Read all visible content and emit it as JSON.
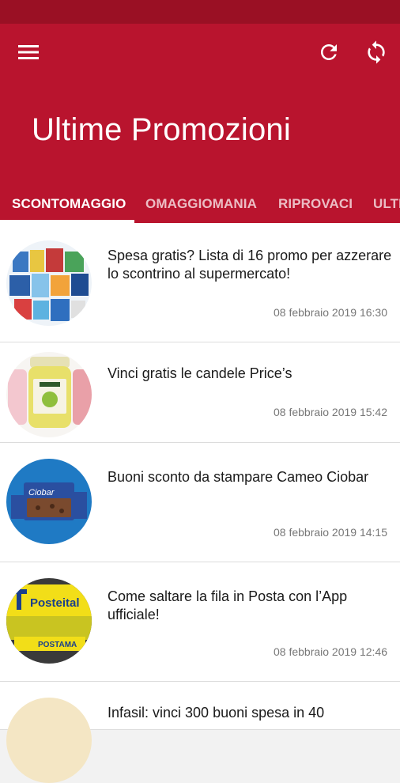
{
  "app": {
    "title": "Ultime Promozioni",
    "colors": {
      "toolbar": "#b9142e",
      "statusbar": "#9a1024",
      "accent": "#ffffff"
    }
  },
  "toolbar": {
    "menu_icon": "menu-icon",
    "refresh_icon": "refresh-icon",
    "sync_icon": "sync-icon"
  },
  "tabs": [
    {
      "label": "SCONTOMAGGIO",
      "active": true
    },
    {
      "label": "OMAGGIOMANIA",
      "active": false
    },
    {
      "label": "RIPROVACI",
      "active": false
    },
    {
      "label": "ULTI",
      "active": false
    }
  ],
  "articles": [
    {
      "title": "Spesa gratis? Lista di 16 promo per azzerare lo scontrino al supermercato!",
      "date": "08 febbraio 2019 16:30"
    },
    {
      "title": "Vinci gratis le candele Price’s",
      "date": "08 febbraio 2019 15:42"
    },
    {
      "title": "Buoni sconto da stampare Cameo Ciobar",
      "date": "08 febbraio 2019 14:15"
    },
    {
      "title": "Come saltare la fila in Posta con l’App ufficiale!",
      "date": "08 febbraio 2019 12:46"
    },
    {
      "title": "Infasil: vinci 300 buoni spesa in 40",
      "date": ""
    }
  ],
  "thumb_labels": {
    "posteitaliane": "Posteital",
    "postamat": "POSTAMA",
    "ciobar": "Ciobar"
  }
}
